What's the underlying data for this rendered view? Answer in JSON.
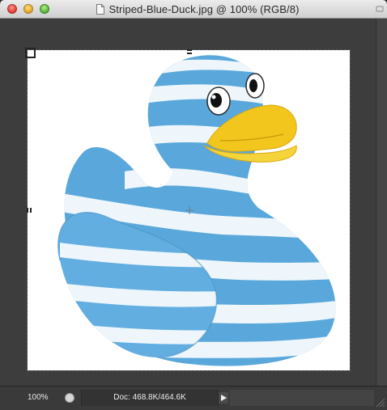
{
  "window": {
    "title": "Striped-Blue-Duck.jpg @ 100% (RGB/8)",
    "icons": [
      "close-button",
      "minimize-button",
      "zoom-button",
      "document-icon"
    ]
  },
  "canvas": {
    "content": "striped blue rubber duck with yellow beak on white background",
    "colors": {
      "stripe_blue": "#5aa8db",
      "stripe_white": "#eef6fb",
      "beak": "#f2c61d",
      "background": "#ffffff"
    }
  },
  "status": {
    "zoom": "100%",
    "doc_info": "Doc: 468.8K/464.6K"
  }
}
